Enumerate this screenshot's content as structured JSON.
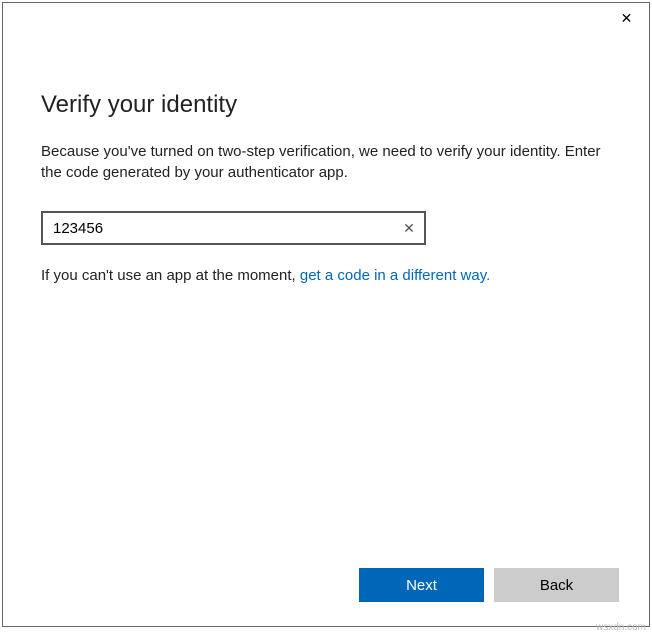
{
  "titlebar": {
    "close_glyph": "✕"
  },
  "main": {
    "heading": "Verify your identity",
    "description": "Because you've turned on two-step verification, we need to verify your identity. Enter the code generated by your authenticator app.",
    "code_value": "123456",
    "clear_glyph": "✕",
    "help_prefix": "If you can't use an app at the moment, ",
    "help_link_text": "get a code in a different way."
  },
  "footer": {
    "next_label": "Next",
    "back_label": "Back"
  },
  "watermark": "wsxdn.com"
}
